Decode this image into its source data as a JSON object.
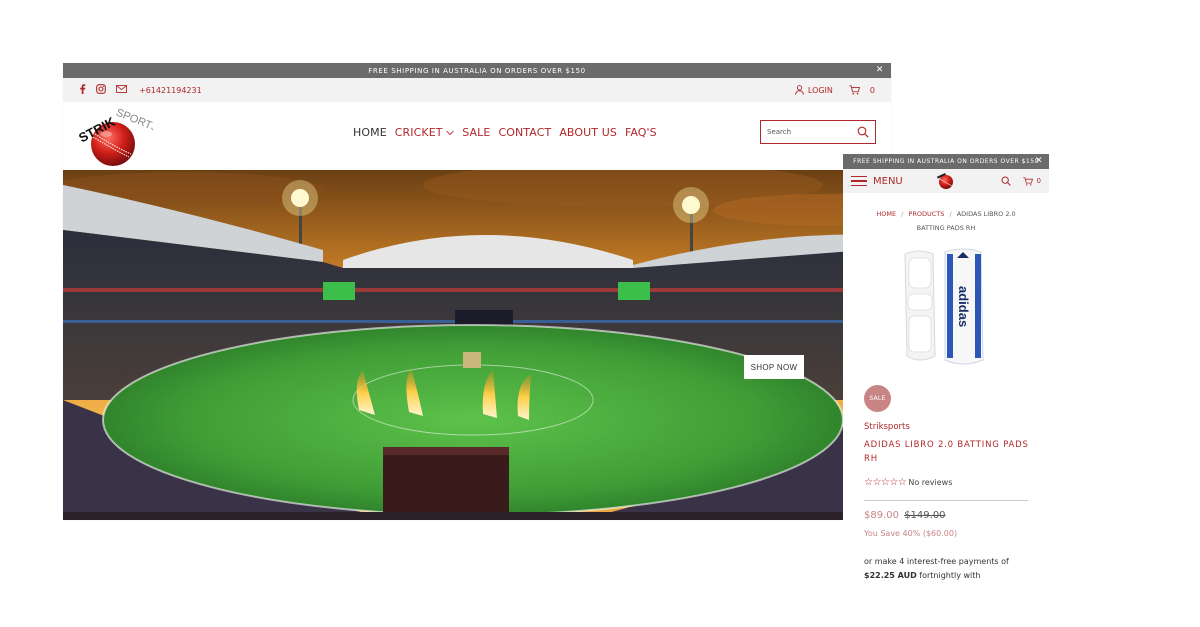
{
  "desktop": {
    "announcement": "FREE SHIPPING IN AUSTRALIA ON ORDERS OVER $150",
    "close_glyph": "✕",
    "topbar": {
      "icons": [
        "facebook-icon",
        "instagram-icon",
        "mail-icon"
      ],
      "phone": "+61421194231",
      "login_label": "LOGIN",
      "cart_count": "0"
    },
    "logo_text_1": "STRIK",
    "logo_text_2": "SPORTS",
    "nav": {
      "home": "HOME",
      "cricket": "CRICKET",
      "sale": "SALE",
      "contact": "CONTACT",
      "about": "ABOUT US",
      "faq": "FAQ'S"
    },
    "search": {
      "placeholder": "Search"
    },
    "hero": {
      "button": "SHOP NOW"
    },
    "colors": {
      "accent": "#b0282b",
      "bar": "#6b6b6b",
      "topbar": "#f2f2f2"
    }
  },
  "mobile": {
    "announcement": "FREE SHIPPING IN AUSTRALIA ON ORDERS OVER $150",
    "close_glyph": "✕",
    "menu_label": "MENU",
    "cart_count": "0",
    "breadcrumb": {
      "home": "HOME",
      "products": "PRODUCTS",
      "current": "ADIDAS LIBRO 2.0 BATTING PADS RH",
      "separator": "/"
    },
    "product": {
      "badge": "SALE",
      "vendor": "Striksports",
      "title": "ADIDAS LIBRO 2.0 BATTING PADS RH",
      "stars": "☆☆☆☆☆",
      "reviews": "No reviews",
      "price_now": "$89.00",
      "price_was": "$149.00",
      "savings": "You Save 40% ($60.00)",
      "installments_prefix": "or make 4 interest-free payments of",
      "installment_amount": "$22.25 AUD",
      "installments_suffix": "fortnightly with",
      "pad_brand": "adidas"
    },
    "colors": {
      "sale_badge": "#c98586",
      "accent": "#b0282b"
    }
  }
}
